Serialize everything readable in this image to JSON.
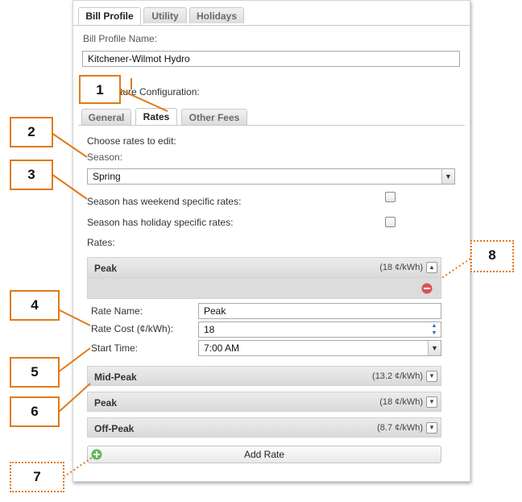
{
  "top_tabs": [
    {
      "label": "Bill Profile",
      "active": true
    },
    {
      "label": "Utility",
      "active": false
    },
    {
      "label": "Holidays",
      "active": false
    }
  ],
  "bill_profile_name_label": "Bill Profile Name:",
  "bill_profile_name_value": "Kitchener-Wilmot Hydro",
  "config_label": "cture Configuration:",
  "sub_tabs": [
    {
      "label": "General",
      "active": false
    },
    {
      "label": "Rates",
      "active": true
    },
    {
      "label": "Other Fees",
      "active": false
    }
  ],
  "choose_rates_label": "Choose rates to edit:",
  "season_label": "Season:",
  "season_value": "Spring",
  "weekend_label": "Season has weekend specific rates:",
  "holiday_label": "Season has holiday specific rates:",
  "rates_label": "Rates:",
  "expanded_rate": {
    "name": "Peak",
    "value": "(18 ¢/kWh)",
    "rate_name_label": "Rate Name:",
    "rate_name_value": "Peak",
    "rate_cost_label": "Rate Cost (¢/kWh):",
    "rate_cost_value": "18",
    "start_time_label": "Start Time:",
    "start_time_value": "7:00 AM"
  },
  "collapsed_rates": [
    {
      "name": "Mid-Peak",
      "value": "(13.2 ¢/kWh)"
    },
    {
      "name": "Peak",
      "value": "(18 ¢/kWh)"
    },
    {
      "name": "Off-Peak",
      "value": "(8.7 ¢/kWh)"
    }
  ],
  "add_rate_label": "Add Rate",
  "callouts": [
    "1",
    "2",
    "3",
    "4",
    "5",
    "6",
    "7",
    "8"
  ],
  "colors": {
    "accent": "#e07b19",
    "remove": "#d9534f",
    "add": "#5cb85c"
  }
}
